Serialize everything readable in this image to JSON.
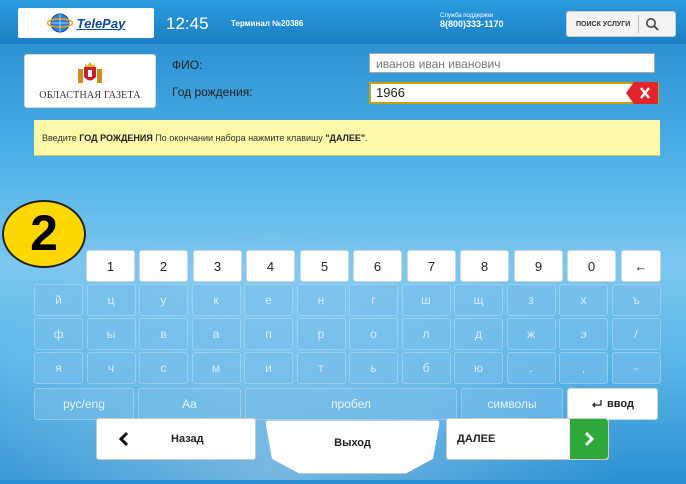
{
  "topbar": {
    "brand": "TelePay",
    "time": "12:45",
    "terminal": "Терминал №20386",
    "support_label": "Служба поддержки",
    "support_phone": "8(800)333-1170",
    "search_label": "ПОИСК УСЛУГИ"
  },
  "provider": {
    "name": "ОБЛАСТНАЯ ГАЗЕТА"
  },
  "form": {
    "fio_label": "ФИО:",
    "fio_value": "иванов иван иванович",
    "year_label": "Год рождения:",
    "year_value": "1966"
  },
  "hint": {
    "prefix": "Введите ",
    "bold1": "ГОД РОЖДЕНИЯ",
    "middle": " По окончании набора нажмите клавишу ",
    "bold2": "\"ДАЛЕЕ\"",
    "suffix": "."
  },
  "badge": "2",
  "keyboard": {
    "row1": [
      "1",
      "2",
      "3",
      "4",
      "5",
      "6",
      "7",
      "8",
      "9",
      "0",
      "←"
    ],
    "row2": [
      "й",
      "ц",
      "у",
      "к",
      "е",
      "н",
      "г",
      "ш",
      "щ",
      "з",
      "х",
      "ъ"
    ],
    "row3": [
      "ф",
      "ы",
      "в",
      "а",
      "п",
      "р",
      "о",
      "л",
      "д",
      "ж",
      "э",
      "/"
    ],
    "row4": [
      "я",
      "ч",
      "с",
      "м",
      "и",
      "т",
      "ь",
      "б",
      "ю",
      ".",
      ",",
      "-"
    ],
    "lang": "рус/eng",
    "case": "Aa",
    "space": "пробел",
    "symbols": "символы",
    "enter": "ввод"
  },
  "nav": {
    "back": "Назад",
    "exit": "Выход",
    "next": "ДАЛЕЕ"
  },
  "colors": {
    "accent_green": "#2fa83a",
    "clear_red": "#e3242b",
    "hint_bg": "#fdf9a8"
  }
}
